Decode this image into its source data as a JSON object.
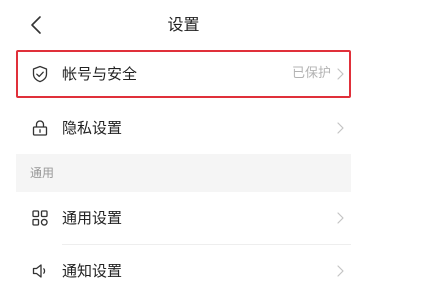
{
  "nav": {
    "title": "设置",
    "back_icon": "chevron-left-icon"
  },
  "rows": {
    "account_security": {
      "label": "帐号与安全",
      "value": "已保护",
      "icon": "shield-check-icon",
      "highlight_color": "#e0303a"
    },
    "privacy": {
      "label": "隐私设置",
      "icon": "lock-icon"
    },
    "general": {
      "label": "通用设置",
      "icon": "grid-icon"
    },
    "notifications": {
      "label": "通知设置",
      "icon": "speaker-icon"
    }
  },
  "sections": {
    "general_header": "通用"
  }
}
